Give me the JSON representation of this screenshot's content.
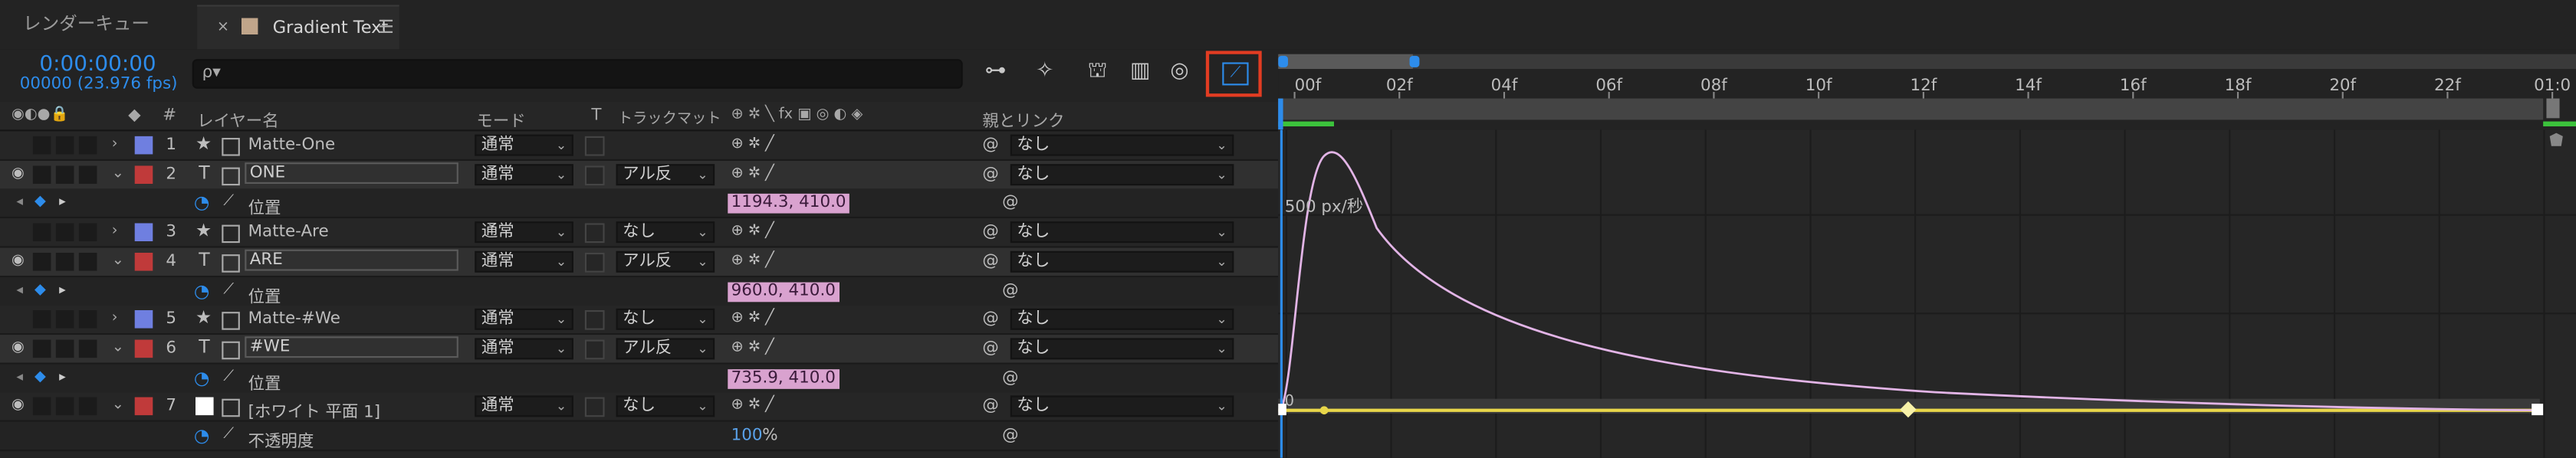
{
  "tabs": {
    "render_queue": "レンダーキュー",
    "comp_close": "×",
    "comp_name": "Gradient Text",
    "comp_menu": "☰"
  },
  "timecode": "0:00:00:00",
  "frame_info": "00000 (23.976 fps)",
  "search": {
    "icon": "ρ▾",
    "value": ""
  },
  "toolbar": {
    "icons": [
      "flowchart-icon",
      "draft-3d-icon",
      "shy-icon",
      "frame-blend-icon",
      "motion-blur-icon",
      "graph-editor-icon"
    ],
    "graph_editor_active": true
  },
  "columns": {
    "layer_name": "レイヤー名",
    "mode": "モード",
    "t": "T",
    "track_matte": "トラックマット",
    "parent": "親とリンク",
    "hash": "#"
  },
  "switch_icons": "⊕ ✲ ╲ fx ▣ ◎ ◐ ◈",
  "layers": [
    {
      "num": "1",
      "type": "star",
      "name": "Matte-One",
      "color": "#6f7fe0",
      "mode": "通常",
      "matte": "",
      "parent": "なし",
      "expanded": false
    },
    {
      "num": "2",
      "type": "T",
      "name": "ONE",
      "color": "#c03a3a",
      "mode": "通常",
      "matte": "アル反",
      "parent": "なし",
      "expanded": true,
      "prop": "位置",
      "value": "1194.3, 410.0"
    },
    {
      "num": "3",
      "type": "star",
      "name": "Matte-Are",
      "color": "#6f7fe0",
      "mode": "通常",
      "matte": "なし",
      "parent": "なし",
      "expanded": false
    },
    {
      "num": "4",
      "type": "T",
      "name": "ARE",
      "color": "#c03a3a",
      "mode": "通常",
      "matte": "アル反",
      "parent": "なし",
      "expanded": true,
      "prop": "位置",
      "value": "960.0, 410.0"
    },
    {
      "num": "5",
      "type": "star",
      "name": "Matte-#We",
      "color": "#6f7fe0",
      "mode": "通常",
      "matte": "なし",
      "parent": "なし",
      "expanded": false
    },
    {
      "num": "6",
      "type": "T",
      "name": "#WE",
      "color": "#c03a3a",
      "mode": "通常",
      "matte": "アル反",
      "parent": "なし",
      "expanded": true,
      "prop": "位置",
      "value": "735.9, 410.0"
    },
    {
      "num": "7",
      "type": "solid",
      "name": "[ホワイト 平面 1]",
      "color": "#c03a3a",
      "mode": "通常",
      "matte": "なし",
      "parent": "なし",
      "expanded": true,
      "prop": "不透明度",
      "value": "100",
      "unit": "%"
    }
  ],
  "timeline": {
    "ruler_labels": [
      "00f",
      "02f",
      "04f",
      "06f",
      "08f",
      "10f",
      "12f",
      "14f",
      "16f",
      "18f",
      "20f",
      "22f",
      "01:0"
    ],
    "graph_label": "500 px/秒",
    "zero_label": "0",
    "curve_color": "#e2b4e6",
    "playhead_color": "#2d8ceb"
  }
}
